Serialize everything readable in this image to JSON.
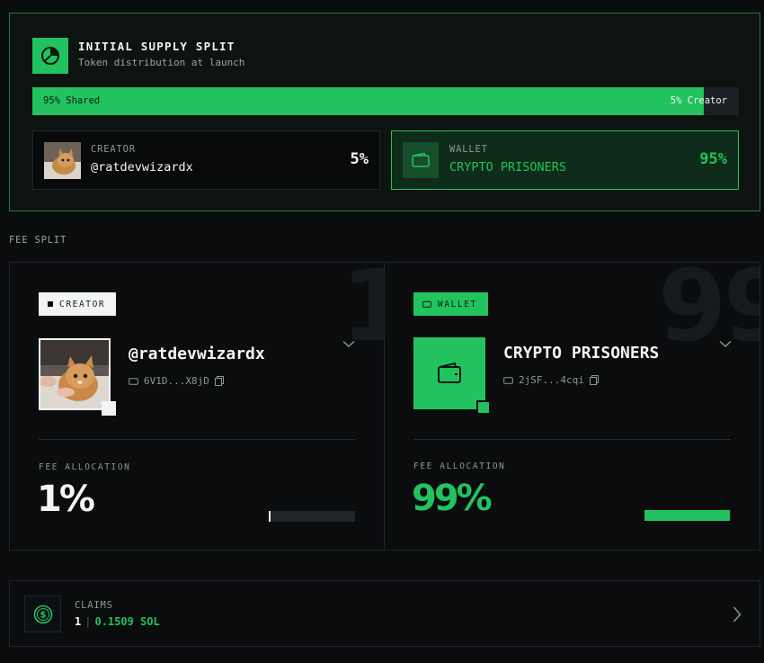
{
  "supply": {
    "title": "INITIAL SUPPLY SPLIT",
    "subtitle": "Token distribution at launch",
    "shared_fraction": 0.95,
    "bar_left_label": "95% Shared",
    "bar_right_label": "5% Creator",
    "creator": {
      "label": "CREATOR",
      "name": "@ratdevwizardx",
      "pct": "5%"
    },
    "wallet": {
      "label": "WALLET",
      "name": "CRYPTO PRISONERS",
      "pct": "95%"
    }
  },
  "fee_split": {
    "heading": "FEE SPLIT",
    "creator": {
      "bg_number": "1",
      "tag": "CREATOR",
      "name": "@ratdevwizardx",
      "address": "6V1D...X8jD",
      "allocation_label": "FEE ALLOCATION",
      "allocation_pct": "1%",
      "allocation_fraction": 0.01
    },
    "wallet": {
      "bg_number": "99",
      "tag": "WALLET",
      "name": "CRYPTO PRISONERS",
      "address": "2jSF...4cqi",
      "allocation_label": "FEE ALLOCATION",
      "allocation_pct": "99%",
      "allocation_fraction": 0.99
    }
  },
  "claims": {
    "label": "CLAIMS",
    "count": "1",
    "separator": "|",
    "amount": "0.1509 SOL"
  },
  "colors": {
    "accent": "#22c35e",
    "background": "#0a0c0d",
    "text": "#f2f5f4"
  }
}
